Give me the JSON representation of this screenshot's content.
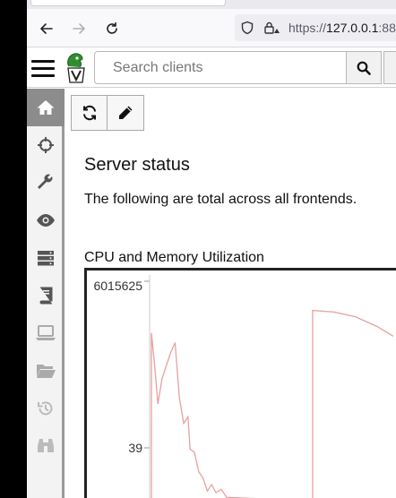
{
  "browser": {
    "url_scheme": "https://",
    "url_host": "127.0.0.1",
    "url_port": ":88"
  },
  "header": {
    "search_placeholder": "Search clients"
  },
  "sidebar": {
    "items": [
      {
        "icon": "home-icon",
        "active": true
      },
      {
        "icon": "crosshairs-icon",
        "active": false
      },
      {
        "icon": "wrench-icon",
        "active": false
      },
      {
        "icon": "eye-icon",
        "active": false
      },
      {
        "icon": "server-icon",
        "active": false
      },
      {
        "icon": "book-icon",
        "active": false
      },
      {
        "icon": "laptop-icon",
        "active": false
      },
      {
        "icon": "folder-open-icon",
        "active": false
      },
      {
        "icon": "history-icon",
        "active": false
      },
      {
        "icon": "binoculars-icon",
        "active": false
      }
    ]
  },
  "toolbar": {
    "refresh_icon": "refresh-icon",
    "edit_icon": "pencil-icon"
  },
  "main": {
    "title": "Server status",
    "description": "The following are total across all frontends.",
    "chart_title": "CPU and Memory Utilization"
  },
  "chart_data": {
    "type": "line",
    "title": "CPU and Memory Utilization",
    "y_tick_labels": [
      "6015625",
      "39"
    ],
    "y_ticks": [
      6015625,
      39
    ],
    "series": [
      {
        "color": "#e8a0a0",
        "points": [
          [
            0.0,
            0
          ],
          [
            0.0,
            5.2
          ],
          [
            0.3,
            4.2
          ],
          [
            0.6,
            3.0
          ],
          [
            1.0,
            3.8
          ],
          [
            1.8,
            4.6
          ],
          [
            2.2,
            4.9
          ],
          [
            2.6,
            3.2
          ],
          [
            3.0,
            2.4
          ],
          [
            3.4,
            2.6
          ],
          [
            3.6,
            1.6
          ],
          [
            4.0,
            1.5
          ],
          [
            4.4,
            0.9
          ],
          [
            4.8,
            0.7
          ],
          [
            5.2,
            0.3
          ],
          [
            5.6,
            0.5
          ],
          [
            6.0,
            0.25
          ],
          [
            6.5,
            0.35
          ],
          [
            7.0,
            0.1
          ],
          [
            15.0,
            0
          ],
          [
            15.0,
            5.9
          ],
          [
            17.0,
            5.85
          ],
          [
            19.0,
            5.7
          ],
          [
            21.0,
            5.4
          ],
          [
            22.5,
            5.1
          ]
        ]
      }
    ],
    "grid": false
  }
}
